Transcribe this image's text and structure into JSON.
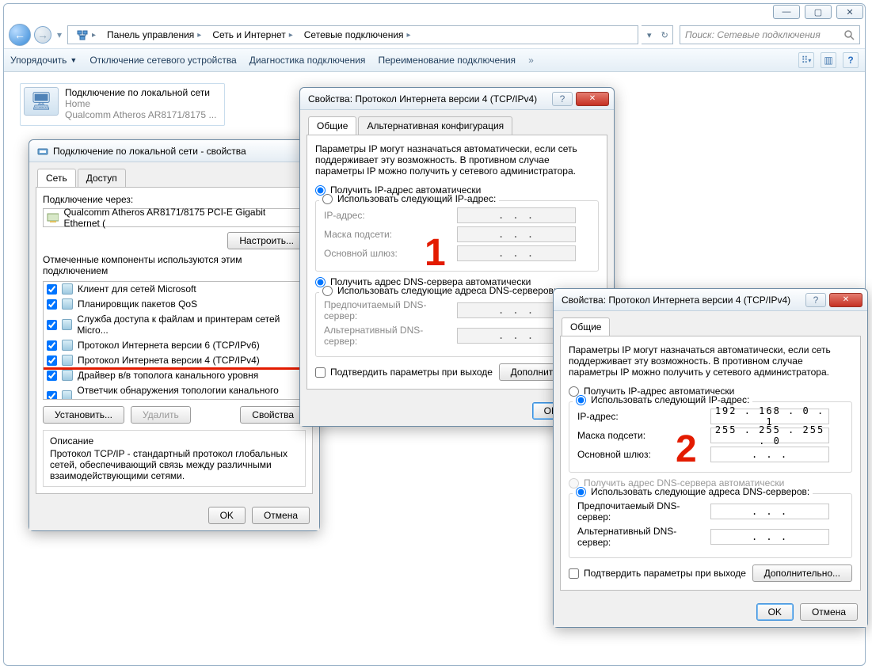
{
  "caption": {
    "min": "—",
    "max": "▢",
    "close": "✕"
  },
  "nav": {
    "back": "←",
    "fwd": "→",
    "drop": "▾"
  },
  "breadcrumb": {
    "items": [
      "Панель управления",
      "Сеть и Интернет",
      "Сетевые подключения"
    ]
  },
  "search": {
    "placeholder": "Поиск: Сетевые подключения"
  },
  "toolbar": {
    "organize": "Упорядочить",
    "disable": "Отключение сетевого устройства",
    "diagnose": "Диагностика подключения",
    "rename": "Переименование подключения"
  },
  "net_item": {
    "name": "Подключение по локальной сети",
    "status": "Home",
    "adapter": "Qualcomm Atheros AR8171/8175 ..."
  },
  "lan_props": {
    "title": "Подключение по локальной сети - свойства",
    "tab_net": "Сеть",
    "tab_access": "Доступ",
    "connect_via": "Подключение через:",
    "adapter": "Qualcomm Atheros AR8171/8175 PCI-E Gigabit Ethernet (",
    "configure": "Настроить...",
    "components_label": "Отмеченные компоненты используются этим подключением",
    "components": [
      "Клиент для сетей Microsoft",
      "Планировщик пакетов QoS",
      "Служба доступа к файлам и принтерам сетей Micro...",
      "Протокол Интернета версии 6 (TCP/IPv6)",
      "Протокол Интернета версии 4 (TCP/IPv4)",
      "Драйвер в/в тополога канального уровня",
      "Ответчик обнаружения топологии канального уровн..."
    ],
    "install": "Установить...",
    "uninstall": "Удалить",
    "properties": "Свойства",
    "desc_hd": "Описание",
    "desc_txt": "Протокол TCP/IP - стандартный протокол глобальных сетей, обеспечивающий связь между различными взаимодействующими сетями.",
    "ok": "OK",
    "cancel": "Отмена"
  },
  "ipv4": {
    "title": "Свойства: Протокол Интернета версии 4 (TCP/IPv4)",
    "tab_general": "Общие",
    "tab_alt": "Альтернативная конфигурация",
    "intro": "Параметры IP могут назначаться автоматически, если сеть поддерживает эту возможность. В противном случае параметры IP можно получить у сетевого администратора.",
    "r_auto_ip": "Получить IP-адрес автоматически",
    "r_manual_ip": "Использовать следующий IP-адрес:",
    "l_ip": "IP-адрес:",
    "l_mask": "Маска подсети:",
    "l_gw": "Основной шлюз:",
    "r_auto_dns": "Получить адрес DNS-сервера автоматически",
    "r_manual_dns": "Использовать следующие адреса DNS-серверов:",
    "l_dns1": "Предпочитаемый DNS-сервер:",
    "l_dns2": "Альтернативный DNS-сервер:",
    "validate": "Подтвердить параметры при выходе",
    "advanced": "Дополнительно...",
    "ok": "OK",
    "cancel": "Отмена",
    "dots": ".       .       .",
    "ip_val": "192 . 168 .   0  .   1",
    "mask_val": "255 . 255 . 255 .   0"
  },
  "annotations": {
    "one": "1",
    "two": "2"
  }
}
